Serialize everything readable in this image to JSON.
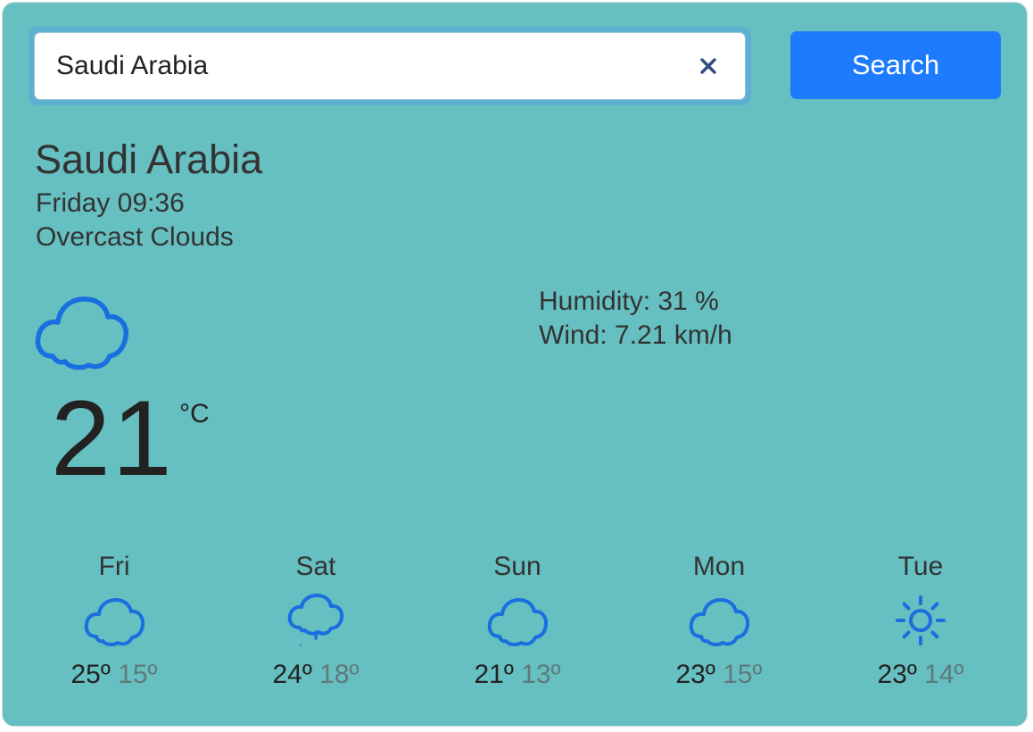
{
  "search": {
    "value": "Saudi Arabia",
    "button_label": "Search",
    "clear_icon": "close-icon"
  },
  "current": {
    "city": "Saudi Arabia",
    "datetime": "Friday 09:36",
    "description": "Overcast Clouds",
    "icon": "cloud-icon",
    "temperature": "21",
    "unit": "°C",
    "humidity": "Humidity: 31 %",
    "wind": "Wind: 7.21 km/h"
  },
  "forecast": [
    {
      "day": "Fri",
      "icon": "cloud-icon",
      "high": "25º",
      "low": "15º"
    },
    {
      "day": "Sat",
      "icon": "cloud-rain-icon",
      "high": "24º",
      "low": "18º"
    },
    {
      "day": "Sun",
      "icon": "cloud-icon",
      "high": "21º",
      "low": "13º"
    },
    {
      "day": "Mon",
      "icon": "cloud-icon",
      "high": "23º",
      "low": "15º"
    },
    {
      "day": "Tue",
      "icon": "sun-icon",
      "high": "23º",
      "low": "14º"
    }
  ],
  "colors": {
    "background": "#66bfc0",
    "button": "#1f7bfd",
    "icon": "#1a6fe0",
    "low_temp": "#5f7a7b"
  }
}
